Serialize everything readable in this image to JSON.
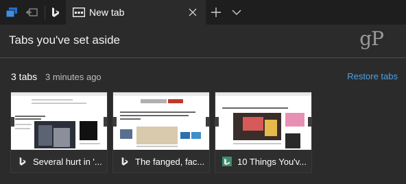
{
  "tab": {
    "title": "New tab"
  },
  "panel": {
    "title": "Tabs you've set aside",
    "brand": "gP"
  },
  "group": {
    "count": "3 tabs",
    "time": "3 minutes ago",
    "restore": "Restore tabs"
  },
  "cards": [
    {
      "title": "Several hurt in '...",
      "favicon": "bing-favicon-icon"
    },
    {
      "title": "The fanged, fac...",
      "favicon": "bing-favicon-icon"
    },
    {
      "title": "10 Things You'v...",
      "favicon": "site-favicon-icon"
    }
  ],
  "colors": {
    "accent": "#4ea1e8",
    "background": "#2b2b2b",
    "tabstrip": "#1e1e1e",
    "favicon_green": "#3a8f6b"
  }
}
